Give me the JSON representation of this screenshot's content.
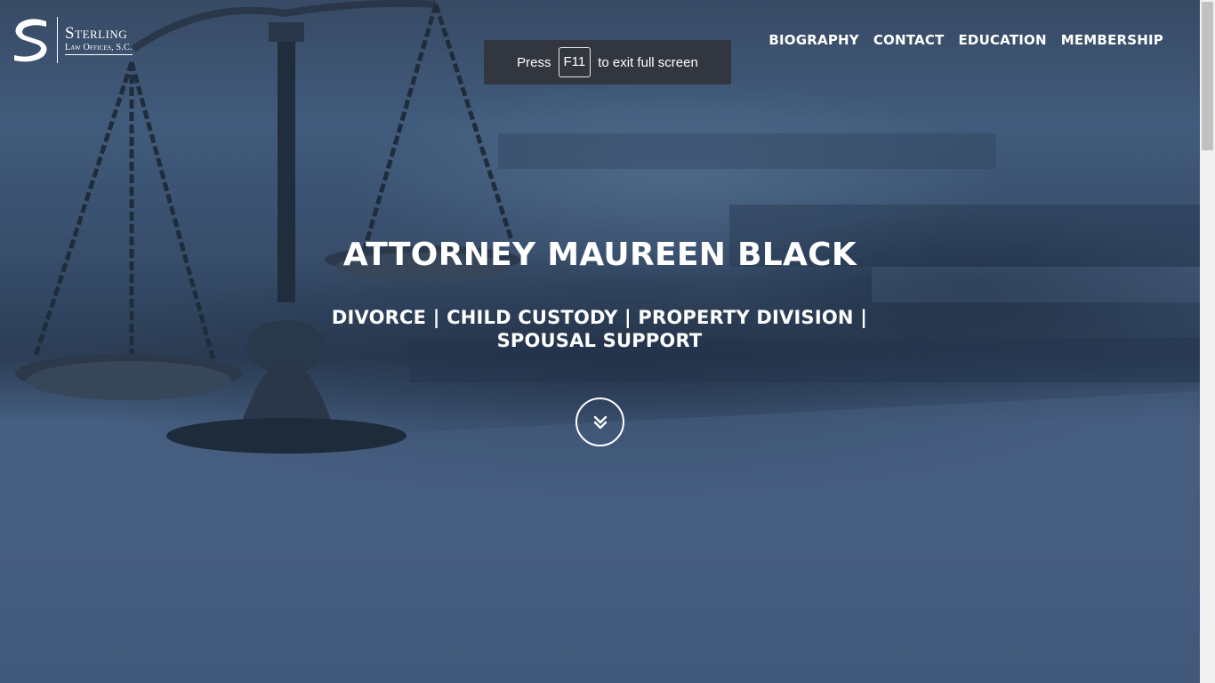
{
  "logo": {
    "name": "Sterling",
    "subtitle": "Law Offices, S.C."
  },
  "nav": {
    "items": [
      {
        "label": "BIOGRAPHY"
      },
      {
        "label": "CONTACT"
      },
      {
        "label": "EDUCATION"
      },
      {
        "label": "MEMBERSHIP"
      }
    ]
  },
  "fullscreen_notice": {
    "prefix": "Press",
    "key": "F11",
    "suffix": "to exit full screen"
  },
  "hero": {
    "title": "ATTORNEY MAUREEN BLACK",
    "subtitle": "DIVORCE | CHILD CUSTODY | PROPERTY DIVISION | SPOUSAL SUPPORT",
    "scroll_icon": "chevron-double-down-icon"
  },
  "colors": {
    "hero_tint": "#3f5674",
    "text": "#ffffff",
    "notice_bg": "#32363d",
    "scrollbar_track": "#f1f1f1",
    "scrollbar_thumb": "#c1c1c1"
  }
}
